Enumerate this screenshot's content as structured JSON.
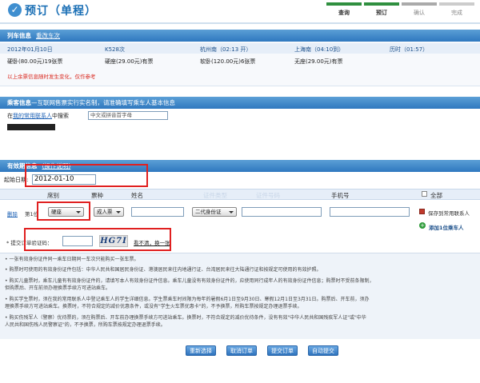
{
  "header": {
    "title": "预订（单程）",
    "icon": "check-icon",
    "steps": [
      "查询",
      "预订",
      "确认",
      "完成"
    ]
  },
  "train": {
    "section_title": "列车信息",
    "change_link": "重改车次",
    "date": "2012年01月10日",
    "train_no": "K528次",
    "from": "杭州南（02:13 开）",
    "to": "上海南（04:10到）",
    "duration": "历时（01:57）",
    "seats": [
      "硬卧(80.00元)19张票",
      "硬座(29.00元)有票",
      "软卧(120.00元)6张票",
      "无座(29.00元)有票"
    ],
    "notice": "以上余票信息随时发生变化，仅作参考"
  },
  "passenger": {
    "section_title": "乘客信息",
    "subtitle": "—互联网售票实行实名制，请准确填写乘车人基本信息",
    "search_prefix": "在",
    "search_link": "我的常用联系人",
    "search_suffix": "中搜索",
    "search_placeholder": "中文或拼音首字母"
  },
  "validity": {
    "section_title": "有效",
    "section_title_tail": "期信息",
    "help_link": "(操作说明)",
    "start_label": "起始日期:",
    "start_value": "2012-01-10"
  },
  "columns": [
    "席别",
    "票种",
    "姓名",
    "证件类型",
    "证件号码",
    "手机号",
    "全部"
  ],
  "row": {
    "delete": "删除",
    "index": "第1位",
    "seat": "硬座",
    "ticket": "成人票",
    "idtype": "二代身份证",
    "save_label": "保存到常用联系人",
    "add_label": "添加1位乘车人"
  },
  "captcha": {
    "label": "* 提交订单验证码：",
    "image_text": "HG7I",
    "refresh_link": "看不清，换一张"
  },
  "notes": [
    "• 一张有效身份证件同一乘车日期同一车次只能购买一张车票。",
    "• 购票时可使用的有效身份证件包括：中华人民共和国居民身份证、港澳居民来往内地通行证、台湾居民来往大陆通行证和按规定可使用的有效护照。",
    "• 购买儿童票时，乘车儿童有有效身份证件的，请填写本人有效身份证件信息。乘车儿童没有有效身份证件的，应使用同行成年人的有效身份证件信息；购票时不受前条限制，",
    "  但购票后、开车前须办理换票手续方可进站乘车。",
    "• 购买学生票时，须在我的常用联系人中登记乘车人的学生详细信息。学生票乘车时间限为每年的暑假6月1日至9月30日、寒假12月1日至3月31日。购票后、开车前，须办",
    "  理换票手续方可进站乘车。换票时，不符合规定的减价优惠条件，或没有\"学生火车票优惠卡\"的，不予换票，所购车票按规定办理退票手续。",
    "• 购买伤残军人（警察）优待票的，须在购票后、开车前办理换票手续方可进站乘车。换票时，不符合规定的减价优待条件，没有有效\"中华人民共和国残疾军人证\"或\"中华",
    "  人民共和国伤残人民警察证\"的，不予换票，所购车票按规定办理退票手续。"
  ],
  "buttons": [
    "重新选择",
    "取消订单",
    "提交订单",
    "自动提交"
  ],
  "colors": {
    "accent": "#2f78bf",
    "alert": "#e02020"
  }
}
